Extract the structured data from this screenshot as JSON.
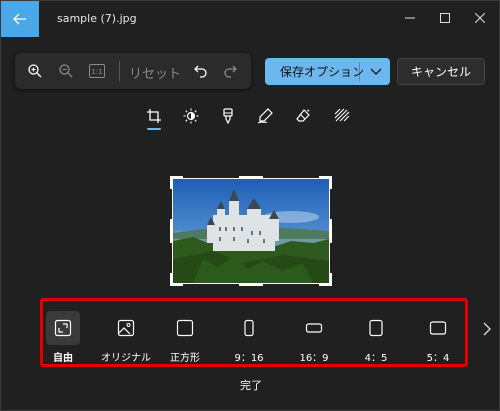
{
  "window": {
    "title": "sample (7).jpg",
    "controls": {
      "minimize": "minimize-icon",
      "maximize": "maximize-icon",
      "close": "close-icon"
    }
  },
  "toolbar": {
    "zoom_in": "zoom-in-icon",
    "zoom_out": "zoom-out-icon",
    "actual_size": "1:1",
    "reset_label": "リセット",
    "undo": "undo-icon",
    "redo": "redo-icon"
  },
  "actions": {
    "save_label": "保存オプション",
    "cancel_label": "キャンセル",
    "done_label": "完了"
  },
  "tool_tabs": [
    {
      "name": "crop-icon",
      "active": true
    },
    {
      "name": "adjust-icon",
      "active": false
    },
    {
      "name": "filter-icon",
      "active": false
    },
    {
      "name": "markup-icon",
      "active": false
    },
    {
      "name": "erase-icon",
      "active": false
    },
    {
      "name": "background-icon",
      "active": false
    }
  ],
  "aspect_ratios": [
    {
      "label": "自由",
      "selected": true
    },
    {
      "label": "オリジナル",
      "selected": false
    },
    {
      "label": "正方形",
      "selected": false
    },
    {
      "label": "9：16",
      "selected": false
    },
    {
      "label": "16：9",
      "selected": false
    },
    {
      "label": "4：5",
      "selected": false
    },
    {
      "label": "5：4",
      "selected": false
    }
  ],
  "colors": {
    "accent": "#6cb8ee",
    "back_button": "#4aa8e8",
    "background": "#202020",
    "highlight_box": "#e00000"
  }
}
